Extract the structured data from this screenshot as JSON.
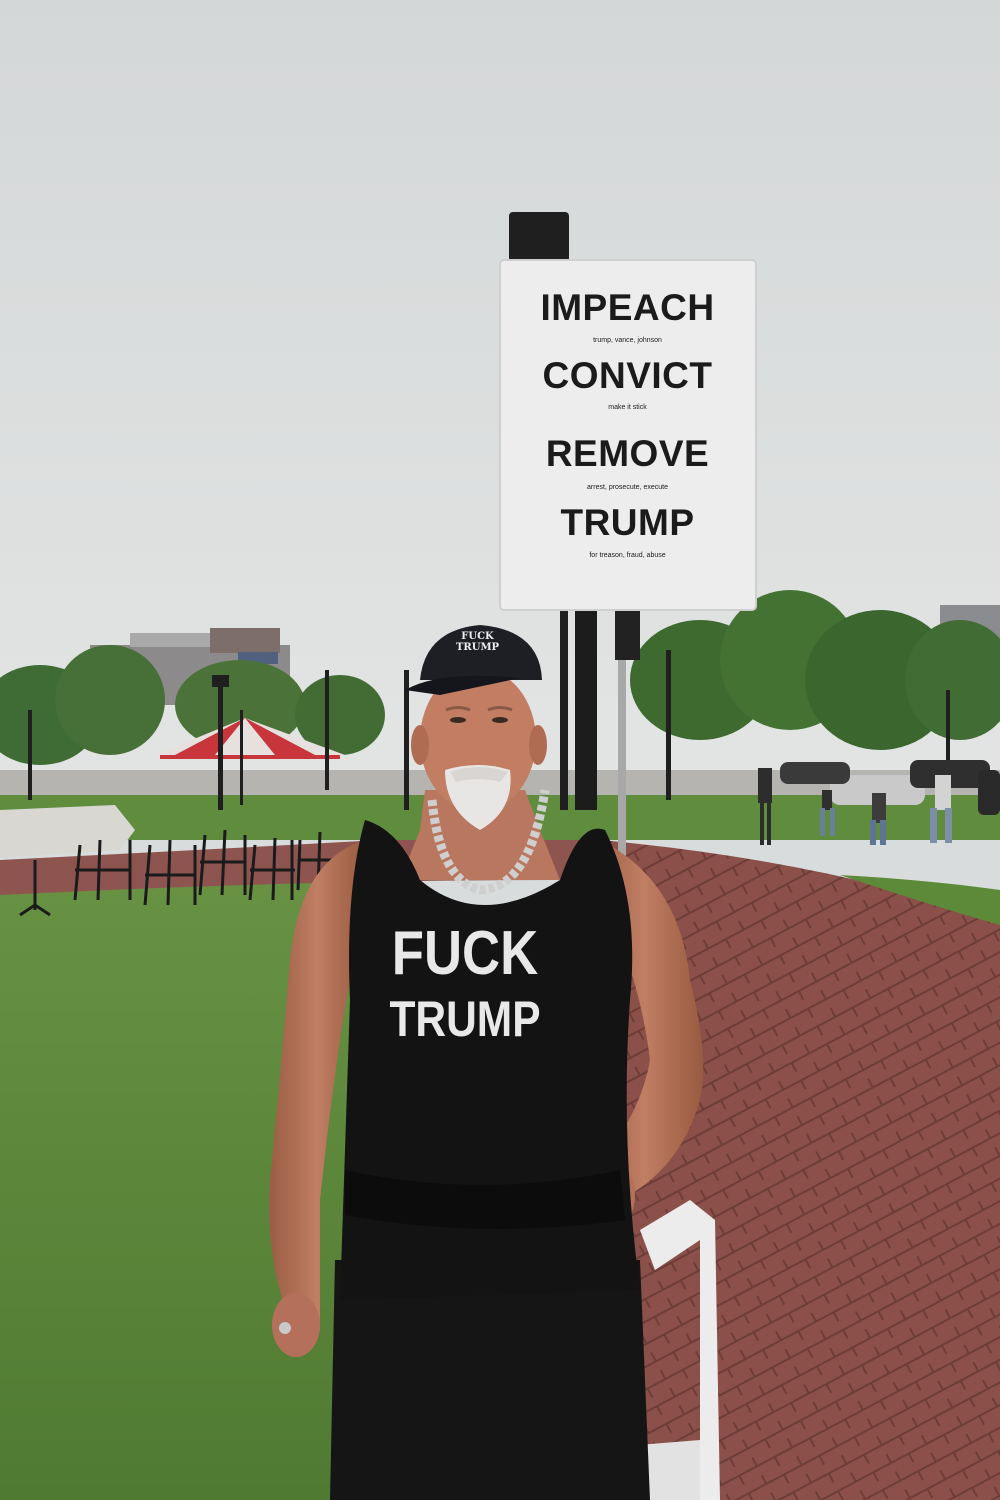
{
  "sign": {
    "line1": "IMPEACH",
    "line1_sub": "trump, vance, johnson",
    "line2": "CONVICT",
    "line2_sub": "make it stick",
    "line3": "REMOVE",
    "line3_sub": "arrest, prosecute, execute",
    "line4": "TRUMP",
    "line4_sub": "for treason, fraud, abuse"
  },
  "shirt": {
    "line1": "FUCK",
    "line2": "TRUMP"
  },
  "cap": {
    "line1": "FUCK",
    "line2": "TRUMP"
  },
  "colors": {
    "sky": "#d9dcdc",
    "grass": "#5f8a3c",
    "brick": "#8a4f49",
    "tent_red": "#c8353b",
    "clothing": "#141414"
  }
}
